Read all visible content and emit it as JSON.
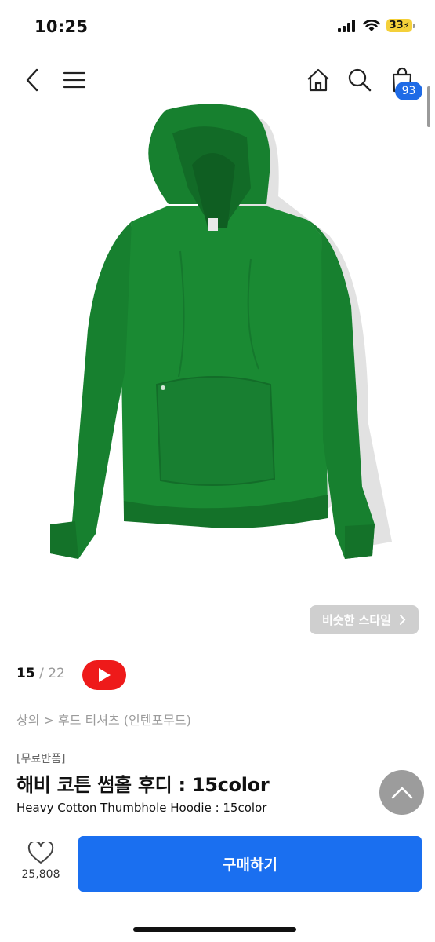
{
  "status_bar": {
    "time": "10:25",
    "battery": "33"
  },
  "header": {
    "cart_count": "93"
  },
  "gallery": {
    "current": "15",
    "separator": "/",
    "total": "22"
  },
  "similar_style_label": "비슷한 스타일",
  "breadcrumb": "상의 > 후드 티셔츠 (인텐포무드)",
  "product": {
    "tag": "[무료반품]",
    "title_ko": "해비 코튼 썸홀 후디 : 15color",
    "title_en": "Heavy Cotton Thumbhole Hoodie : 15color",
    "color": "#17802f"
  },
  "actions": {
    "like_count": "25,808",
    "buy_label": "구매하기"
  },
  "theme": {
    "accent": "#1a6ff0",
    "youtube": "#ee1a1a",
    "badge": "#1f6be6"
  }
}
